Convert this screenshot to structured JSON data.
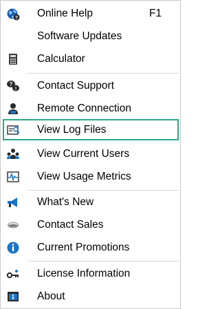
{
  "menu": {
    "items": [
      {
        "label": "Online Help",
        "shortcut": "F1",
        "icon": "help-globe-icon"
      },
      {
        "label": "Software Updates",
        "icon": ""
      },
      {
        "label": "Calculator",
        "icon": "calculator-icon"
      },
      {
        "label": "Contact Support",
        "icon": "support-chat-icon"
      },
      {
        "label": "Remote Connection",
        "icon": "remote-connection-icon"
      },
      {
        "label": "View Log Files",
        "icon": "log-files-icon",
        "highlighted": true
      },
      {
        "label": "View Current Users",
        "icon": "users-icon"
      },
      {
        "label": "View Usage Metrics",
        "icon": "metrics-icon"
      },
      {
        "label": "What's New",
        "icon": "megaphone-icon"
      },
      {
        "label": "Contact Sales",
        "icon": "handshake-icon"
      },
      {
        "label": "Current Promotions",
        "icon": "info-icon"
      },
      {
        "label": "License Information",
        "icon": "key-icon"
      },
      {
        "label": "About",
        "icon": "about-icon"
      }
    ]
  },
  "colors": {
    "highlight_border": "#2aa686",
    "icon_blue": "#1a73c7",
    "icon_dark": "#2b2b2b",
    "separator": "#d6d6d6"
  }
}
